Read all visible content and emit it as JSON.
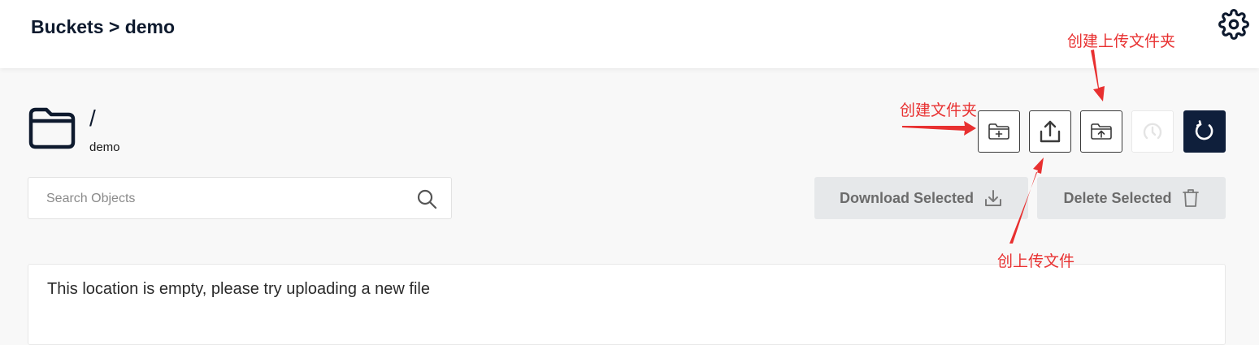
{
  "header": {
    "breadcrumb": "Buckets > demo",
    "settings_icon": "gear-icon"
  },
  "location": {
    "path": "/",
    "bucket": "demo",
    "folder_icon": "folder-icon"
  },
  "toolbar": {
    "buttons": [
      {
        "name": "create-folder-button",
        "icon": "folder-plus-icon",
        "state": "enabled"
      },
      {
        "name": "upload-file-button",
        "icon": "upload-icon",
        "state": "enabled"
      },
      {
        "name": "upload-folder-button",
        "icon": "folder-upload-icon",
        "state": "enabled"
      },
      {
        "name": "rewind-button",
        "icon": "history-icon",
        "state": "disabled"
      },
      {
        "name": "refresh-button",
        "icon": "refresh-icon",
        "state": "active"
      }
    ]
  },
  "search": {
    "placeholder": "Search Objects",
    "value": ""
  },
  "actions": {
    "download_label": "Download Selected",
    "delete_label": "Delete Selected"
  },
  "objects": {
    "empty_message": "This location is empty, please try uploading a new file"
  },
  "annotations": {
    "create_folder": "创建文件夹",
    "upload_folder": "创建上传文件夹",
    "upload_file": "创上传文件"
  },
  "colors": {
    "primary": "#0f1f3b",
    "annotation": "#e83030",
    "action_bg": "#e6e8ea"
  }
}
